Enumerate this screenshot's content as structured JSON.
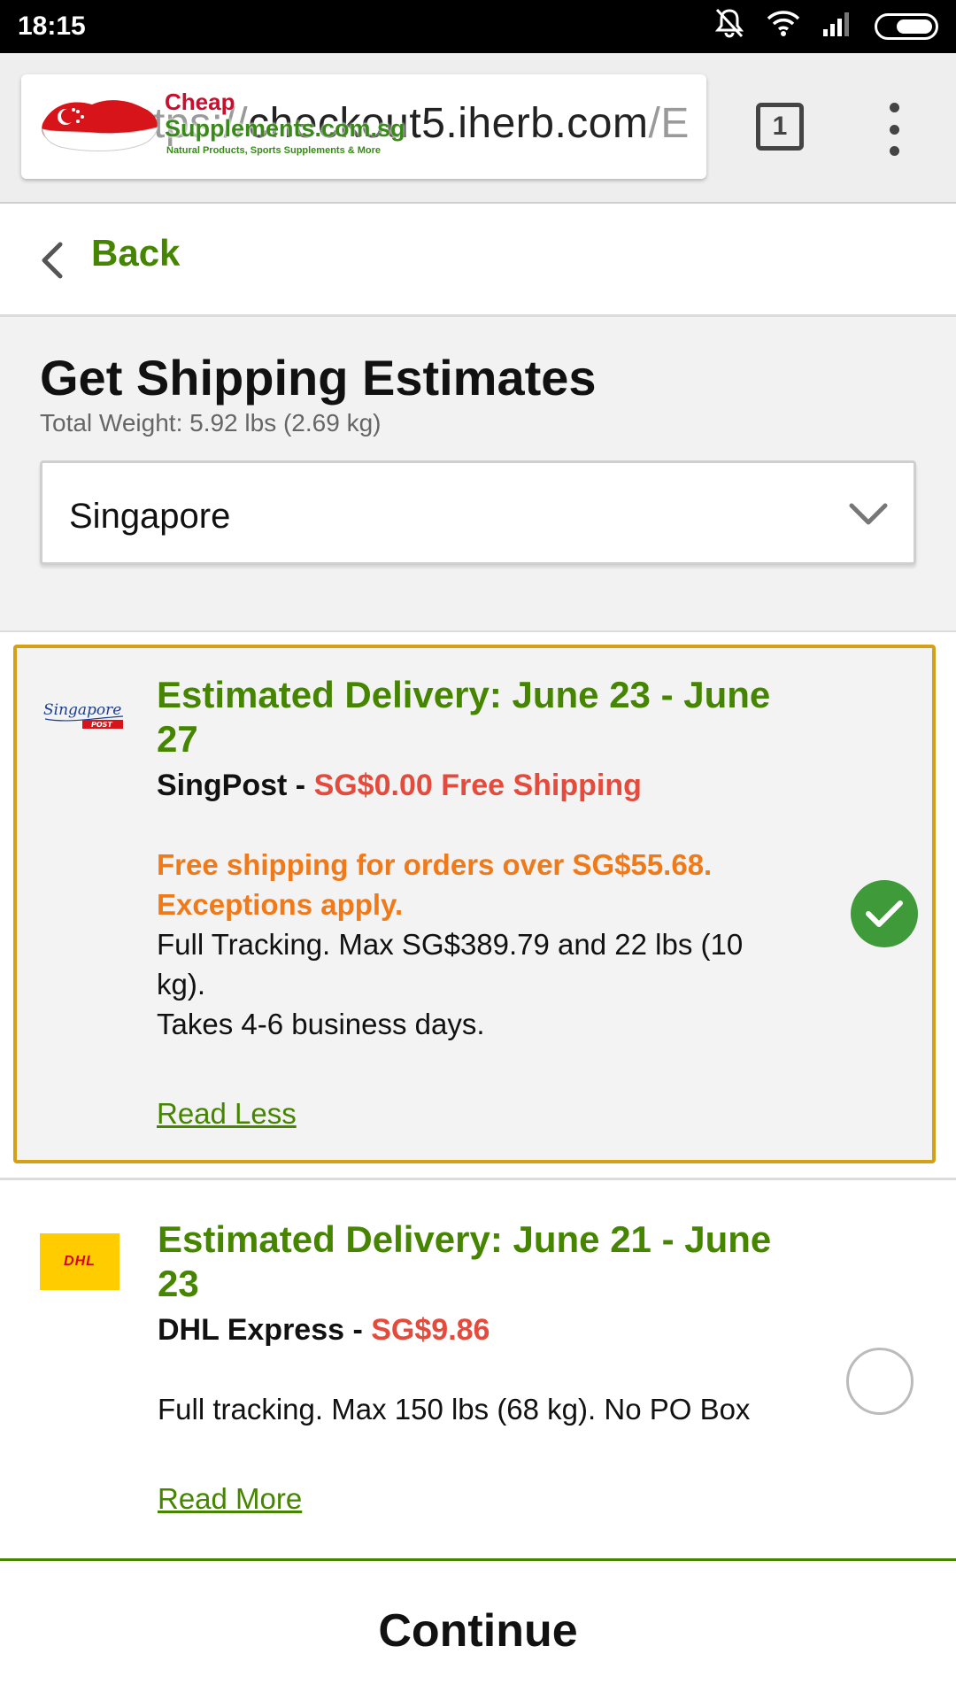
{
  "status_bar": {
    "time": "18:15",
    "icons": [
      "mute-icon",
      "wifi-icon",
      "signal-icon",
      "battery-icon"
    ]
  },
  "browser": {
    "url_prefix": "https://",
    "url_host": "checkout5.iherb.com",
    "url_suffix": "/E",
    "tab_count": "1",
    "watermark": {
      "line1": "Cheap",
      "line2": "Supplements.com.sg",
      "tagline": "Natural Products, Sports Supplements & More"
    }
  },
  "nav": {
    "back_label": "Back"
  },
  "estimates": {
    "title": "Get Shipping Estimates",
    "total_weight": "Total Weight: 5.92 lbs (2.69 kg)",
    "country": "Singapore"
  },
  "options": [
    {
      "carrier_logo": "singapore-post-logo",
      "delivery_line1": "Estimated Delivery: June 23 - June",
      "delivery_line2": "27",
      "carrier": "SingPost -",
      "price": "SG$0.00 Free Shipping",
      "promo_line1": "Free shipping for orders over SG$55.68.",
      "promo_line2": "Exceptions apply.",
      "desc_line1": "Full Tracking. Max SG$389.79 and 22 lbs (10",
      "desc_line2": "kg).",
      "desc_line3": "Takes 4-6 business days.",
      "link": "Read Less",
      "selected": true
    },
    {
      "carrier_logo": "dhl-logo",
      "logo_text": "DHL",
      "delivery_line1": "Estimated Delivery: June 21 - June",
      "delivery_line2": "23",
      "carrier": "DHL Express -",
      "price": "SG$9.86",
      "desc_line1": "Full tracking. Max 150 lbs (68 kg). No PO Box",
      "link": "Read More",
      "selected": false
    }
  ],
  "footer": {
    "continue_label": "Continue"
  },
  "colors": {
    "brand_green": "#458500",
    "price_red": "#e54b3c",
    "promo_orange": "#f07a1a",
    "selected_border": "#d4a017",
    "check_green": "#3f9b3a"
  }
}
